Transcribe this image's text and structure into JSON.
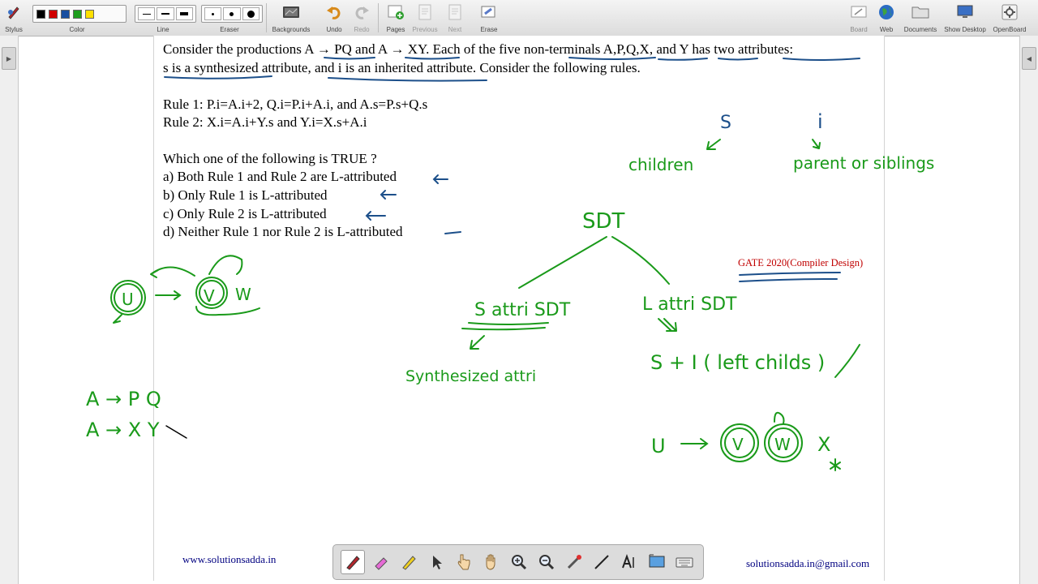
{
  "toolbar": {
    "stylus": "Stylus",
    "color": "Color",
    "line": "Line",
    "eraser": "Eraser",
    "backgrounds": "Backgrounds",
    "undo": "Undo",
    "redo": "Redo",
    "pages": "Pages",
    "previous": "Previous",
    "next": "Next",
    "erase": "Erase",
    "board": "Board",
    "web": "Web",
    "documents": "Documents",
    "show_desktop": "Show Desktop",
    "openboard": "OpenBoard",
    "colors": [
      "#000000",
      "#d00000",
      "#1a4fa0",
      "#1e9e1e",
      "#ffe000"
    ]
  },
  "question": {
    "line1": "Consider the productions A → PQ and A → XY. Each of the five non-terminals A,P,Q,X, and Y has two attributes:",
    "line2": "s is a synthesized attribute, and i is an inherited attribute. Consider the following rules.",
    "rule1": "Rule 1: P.i=A.i+2, Q.i=P.i+A.i, and A.s=P.s+Q.s",
    "rule2": "Rule 2: X.i=A.i+Y.s and Y.i=X.s+A.i",
    "prompt": "Which one of the following is TRUE ?",
    "options": [
      "a) Both Rule 1 and Rule 2 are L-attributed",
      "b) Only Rule 1 is L-attributed",
      "c) Only Rule 2 is L-attributed",
      "d) Neither Rule 1 nor Rule 2 is L-attributed"
    ]
  },
  "gate_label": "GATE 2020(Compiler Design)",
  "footer": {
    "website": "www.solutionsadda.in",
    "email": "solutionsadda.in@gmail.com"
  },
  "handwriting": {
    "s": "S",
    "i": "i",
    "children": "children",
    "parent_siblings": "parent or siblings",
    "sdt": "SDT",
    "s_attri": "S attri SDT",
    "l_attri": "L attri SDT",
    "synthesized": "Synthesized attri",
    "s_plus_i": "S + I ( left childs )",
    "u": "U",
    "v": "V",
    "w": "W",
    "apq": "A → P Q",
    "axy": "A → X Y",
    "x": "X"
  },
  "colors": {
    "ink_green": "#1a9a1a",
    "ink_blue": "#1c4f8a",
    "gate_red": "#c00000",
    "footer_navy": "#000080"
  },
  "bottom_tools": [
    "pen-icon",
    "highlighter-icon",
    "marker-icon",
    "pointer-icon",
    "hand-pointer-icon",
    "hand-icon",
    "zoom-in-icon",
    "zoom-out-icon",
    "laser-icon",
    "line-icon",
    "text-icon",
    "capture-icon",
    "keyboard-icon"
  ]
}
